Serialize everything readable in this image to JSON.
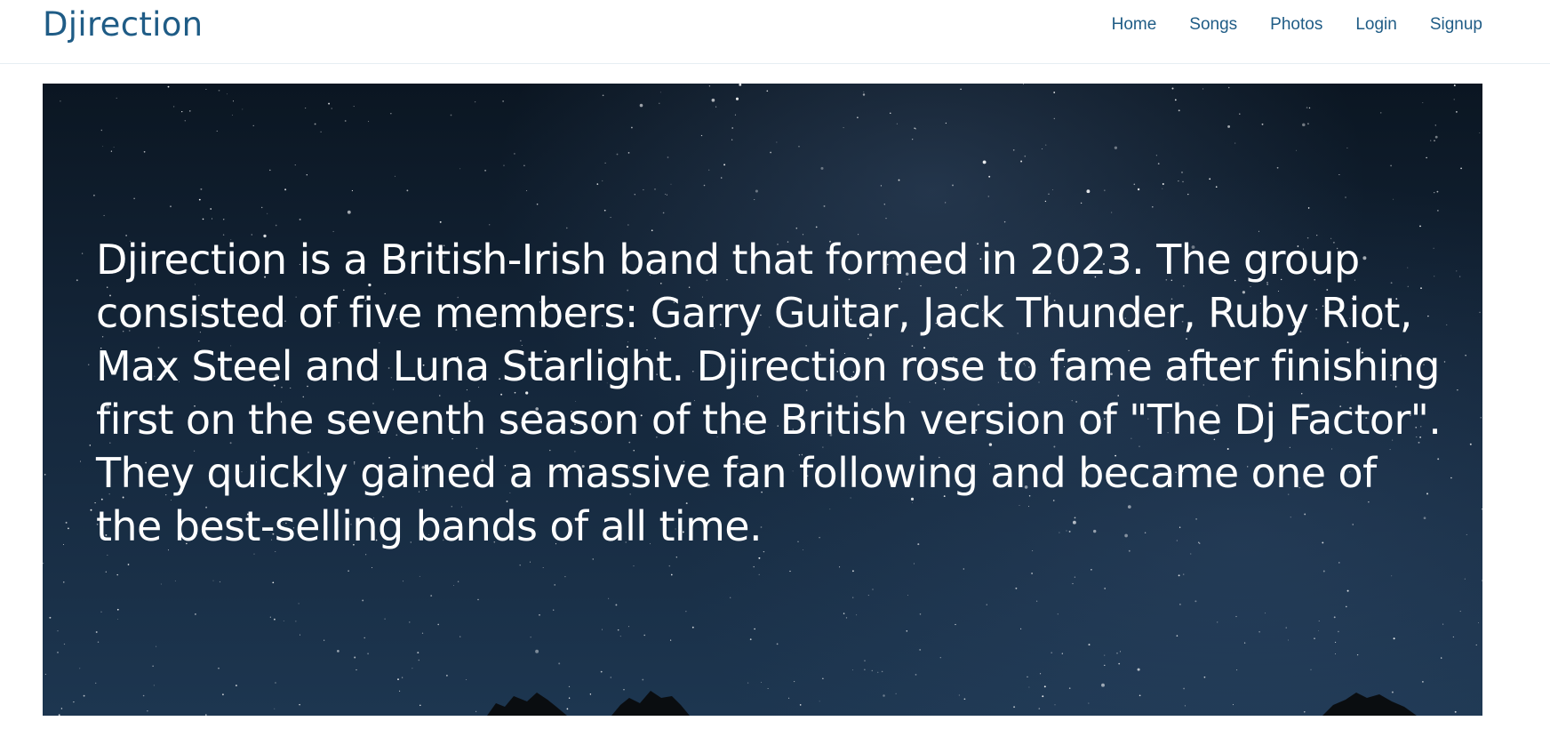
{
  "brand": "Djirection",
  "nav": {
    "items": [
      {
        "label": "Home"
      },
      {
        "label": "Songs"
      },
      {
        "label": "Photos"
      },
      {
        "label": "Login"
      },
      {
        "label": "Signup"
      }
    ]
  },
  "hero": {
    "text": "Djirection is a British-Irish band that formed in 2023. The group consisted of five members: Garry Guitar, Jack Thunder, Ruby Riot, Max Steel and Luna Starlight. Djirection rose to fame after finishing first on the seventh season of the British version of \"The Dj Factor\". They quickly gained a massive fan following and became one of the best-selling bands of all time."
  },
  "colors": {
    "accent": "#1f5c86",
    "hero_sky_top": "#0b1622",
    "hero_sky_bottom": "#1d3650"
  }
}
